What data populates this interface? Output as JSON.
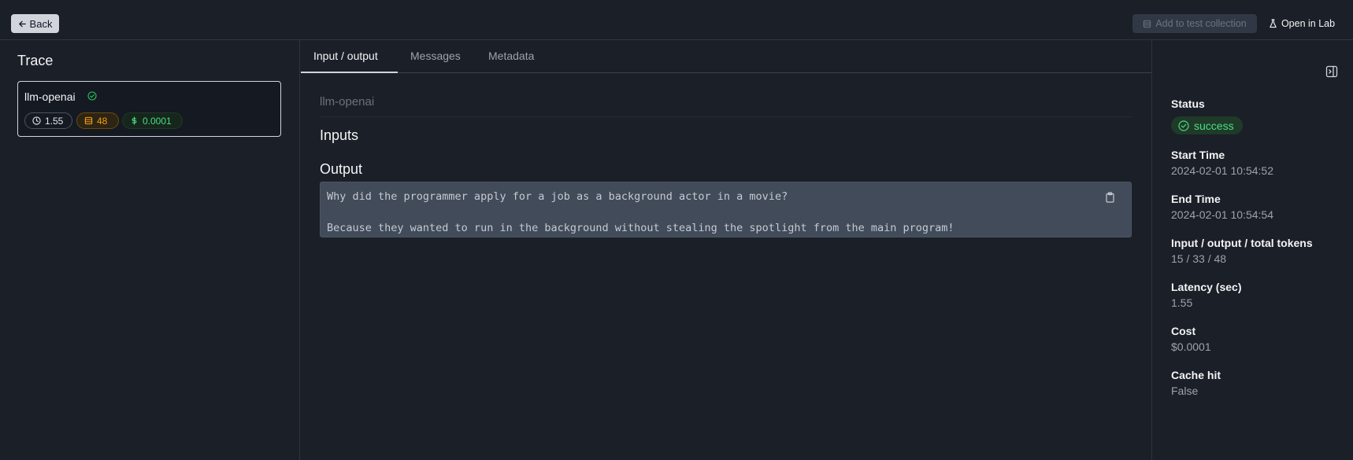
{
  "header": {
    "back_label": "Back",
    "add_to_collection_label": "Add to test collection",
    "open_in_lab_label": "Open in Lab"
  },
  "trace": {
    "title": "Trace",
    "item": {
      "name": "llm-openai",
      "latency": "1.55",
      "tokens": "48",
      "cost": "0.0001"
    }
  },
  "tabs": [
    {
      "label": "Input / output",
      "active": true
    },
    {
      "label": "Messages",
      "active": false
    },
    {
      "label": "Metadata",
      "active": false
    }
  ],
  "main": {
    "span_name": "llm-openai",
    "inputs_title": "Inputs",
    "output_title": "Output",
    "output_line1": "Why did the programmer apply for a job as a background actor in a movie?",
    "output_line2": "Because they wanted to run in the background without stealing the spotlight from the main program!"
  },
  "details": {
    "status_label": "Status",
    "status_value": "success",
    "start_time_label": "Start Time",
    "start_time_value": "2024-02-01 10:54:52",
    "end_time_label": "End Time",
    "end_time_value": "2024-02-01 10:54:54",
    "tokens_label": "Input / output / total tokens",
    "tokens_value": "15 / 33 / 48",
    "latency_label": "Latency (sec)",
    "latency_value": "1.55",
    "cost_label": "Cost",
    "cost_value": "$0.0001",
    "cache_label": "Cache hit",
    "cache_value": "False"
  },
  "colors": {
    "background": "#1b1f27",
    "success": "#4ade80",
    "tokens": "#f59e0b",
    "output_box": "#424b59"
  },
  "icons": [
    "arrow-left-icon",
    "database-icon",
    "flask-icon",
    "check-circle-icon",
    "clock-icon",
    "dollar-icon",
    "clipboard-icon",
    "panel-toggle-icon"
  ]
}
